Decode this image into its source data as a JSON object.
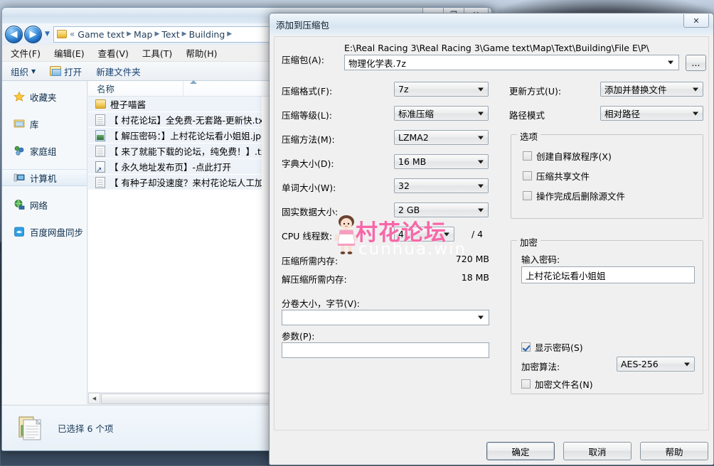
{
  "desktop": {
    "bg_top": "#a8bcd2",
    "bg_bottom": "#22303f"
  },
  "explorer": {
    "window_controls": [
      {
        "name": "minimize",
        "glyph": "—"
      },
      {
        "name": "maximize",
        "glyph": "❐"
      },
      {
        "name": "close",
        "glyph": "✕"
      }
    ],
    "nav": {
      "back": "◀",
      "forward": "▶",
      "history_caret": "▼"
    },
    "breadcrumb": {
      "overflow": "«",
      "items": [
        "Game text",
        "Map",
        "Text",
        "Building"
      ],
      "separator": "▶",
      "trailing_separator": "▶"
    },
    "menubar": [
      "文件(F)",
      "编辑(E)",
      "查看(V)",
      "工具(T)",
      "帮助(H)"
    ],
    "toolbar": {
      "organize": "组织",
      "organize_caret": "▼",
      "open": "打开",
      "new_folder": "新建文件夹"
    },
    "navpane": [
      {
        "label": "收藏夹",
        "icon": "star-icon",
        "selected": false
      },
      {
        "label": "库",
        "icon": "library-icon",
        "selected": false
      },
      {
        "label": "家庭组",
        "icon": "homegroup-icon",
        "selected": false
      },
      {
        "label": "计算机",
        "icon": "computer-icon",
        "selected": true
      },
      {
        "label": "网络",
        "icon": "network-icon",
        "selected": false
      },
      {
        "label": "百度网盘同步",
        "icon": "baidu-netdisk-icon",
        "selected": false
      }
    ],
    "column_header": "名称",
    "files": [
      {
        "name": "橙子喵酱",
        "type": "folder"
      },
      {
        "name": "【 村花论坛】全免费-无套路-更新快.txt",
        "type": "txt"
      },
      {
        "name": "【 解压密码：】上村花论坛看小姐姐.jpg",
        "type": "jpg"
      },
      {
        "name": "【 来了就能下载的论坛，纯免费！】.txt",
        "type": "txt"
      },
      {
        "name": "【 永久地址发布页】-点此打开",
        "type": "lnk"
      },
      {
        "name": "【 有种子却没速度？来村花论坛人工加...",
        "type": "txt"
      }
    ],
    "scrollbar": {
      "left_arrow": "◀",
      "right_arrow": "▶"
    },
    "status": "已选择 6 个项"
  },
  "dialog": {
    "title": "添加到压缩包",
    "close_glyph": "✕",
    "archive": {
      "label": "压缩包(A):",
      "path": "E:\\Real Racing 3\\Real Racing 3\\Game text\\Map\\Text\\Building\\File E\\P\\",
      "value": "物理化学表.7z",
      "browse_label": "..."
    },
    "left_fields": [
      {
        "label": "压缩格式(F):",
        "value": "7z"
      },
      {
        "label": "压缩等级(L):",
        "value": "标准压缩"
      },
      {
        "label": "压缩方法(M):",
        "value": "LZMA2"
      },
      {
        "label": "字典大小(D):",
        "value": "16 MB"
      },
      {
        "label": "单词大小(W):",
        "value": "32"
      },
      {
        "label": "固实数据大小:",
        "value": "2 GB"
      }
    ],
    "cpu": {
      "label": "CPU 线程数:",
      "value": "4",
      "total": "/ 4"
    },
    "memory": [
      {
        "label": "压缩所需内存:",
        "value": "720 MB"
      },
      {
        "label": "解压缩所需内存:",
        "value": "18 MB"
      }
    ],
    "split": {
      "label": "分卷大小，字节(V):",
      "value": ""
    },
    "params": {
      "label": "参数(P):",
      "value": ""
    },
    "right_fields": [
      {
        "label": "更新方式(U):",
        "value": "添加并替换文件"
      },
      {
        "label": "路径模式",
        "value": "相对路径"
      }
    ],
    "options": {
      "title": "选项",
      "items": [
        {
          "label": "创建自释放程序(X)",
          "checked": false
        },
        {
          "label": "压缩共享文件",
          "checked": false
        },
        {
          "label": "操作完成后删除源文件",
          "checked": false
        }
      ]
    },
    "encryption": {
      "title": "加密",
      "password_label": "输入密码:",
      "password_value": "上村花论坛看小姐姐",
      "show_password": {
        "label": "显示密码(S)",
        "checked": true
      },
      "algorithm_label": "加密算法:",
      "algorithm_value": "AES-256",
      "encrypt_names": {
        "label": "加密文件名(N)",
        "checked": false
      }
    },
    "buttons": [
      {
        "label": "确定",
        "default": true
      },
      {
        "label": "取消",
        "default": false
      },
      {
        "label": "帮助",
        "default": false
      }
    ]
  },
  "watermark": {
    "text": "村花论坛",
    "subtext": "cunhua.win",
    "color": "#f767a8"
  }
}
